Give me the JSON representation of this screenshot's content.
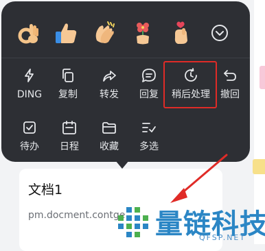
{
  "reactions": [
    {
      "name": "ok-hand"
    },
    {
      "name": "thumbs-up"
    },
    {
      "name": "clapping-hands"
    },
    {
      "name": "holding-flower"
    },
    {
      "name": "finger-heart"
    }
  ],
  "actions_row1": [
    "DING",
    "复制",
    "转发",
    "回复",
    "稍后处理",
    "撤回"
  ],
  "actions_row2": [
    "待办",
    "日程",
    "收藏",
    "多选"
  ],
  "card": {
    "title": "文档1",
    "link": "pm.docment.contge"
  },
  "watermark": {
    "text": "量链科技",
    "domain": "QFSP.NET"
  },
  "colors": {
    "menu_bg": "#2d2f34",
    "highlight": "#e02b27",
    "arrow": "#e02b27",
    "watermark": "#2b86c5"
  }
}
